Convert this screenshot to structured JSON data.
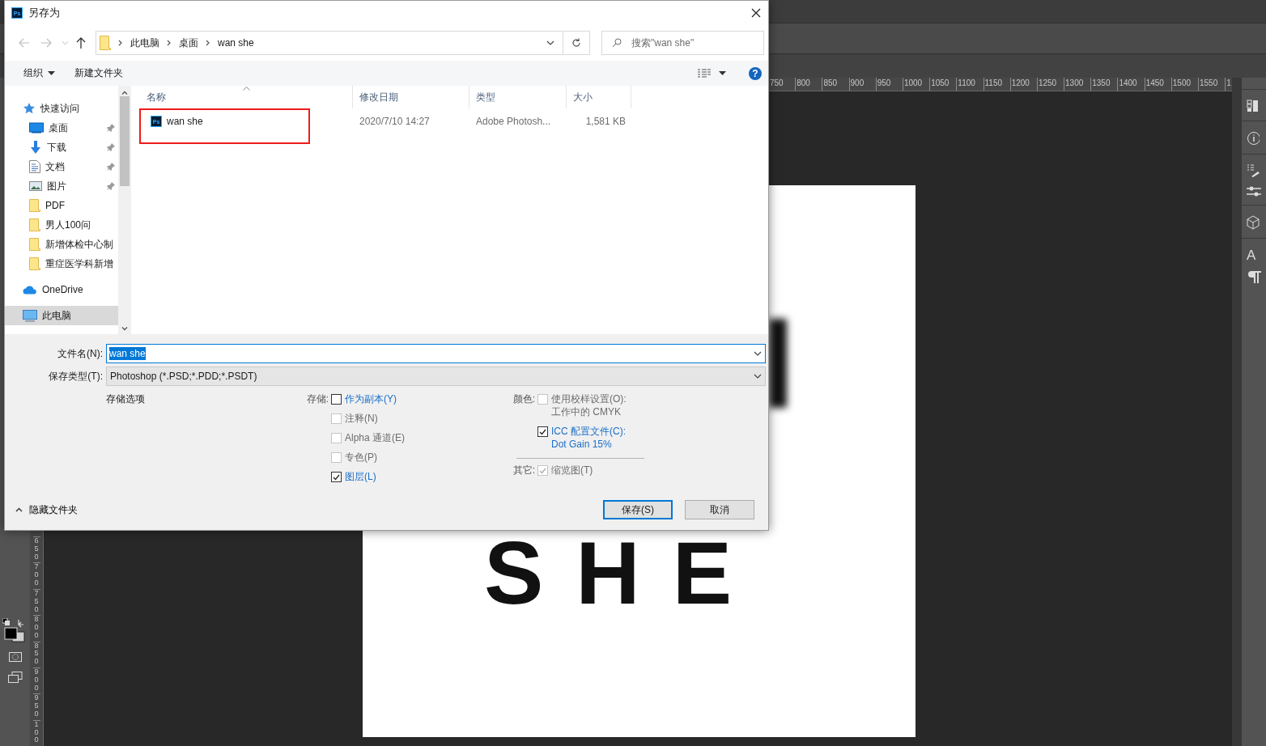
{
  "photoshop": {
    "h_ruler": [
      "750",
      "800",
      "850",
      "900",
      "950",
      "1000",
      "1050",
      "1100",
      "1150",
      "1200",
      "1250",
      "1300",
      "1350",
      "1400",
      "1450",
      "1500",
      "1550",
      "1"
    ],
    "v_ruler": [
      "650",
      "700",
      "750",
      "800",
      "850",
      "900",
      "950",
      "100"
    ],
    "canvas_text": "SHE",
    "panel_letter": "A"
  },
  "dialog": {
    "icon_label": "Ps",
    "title": "另存为",
    "breadcrumb": [
      "此电脑",
      "桌面",
      "wan she"
    ],
    "search": {
      "placeholder": "搜索\"wan she\""
    },
    "toolbar": {
      "organize": "组织",
      "new_folder": "新建文件夹",
      "help": "?"
    },
    "sidebar": [
      {
        "label": "快速访问",
        "kind": "star",
        "pinned": false,
        "selected": false,
        "children": [
          {
            "label": "桌面",
            "kind": "desktop",
            "pinned": true,
            "selected": false
          },
          {
            "label": "下载",
            "kind": "download",
            "pinned": true,
            "selected": false
          },
          {
            "label": "文档",
            "kind": "document",
            "pinned": true,
            "selected": false
          },
          {
            "label": "图片",
            "kind": "pictures",
            "pinned": true,
            "selected": false
          },
          {
            "label": "PDF",
            "kind": "folder",
            "pinned": false,
            "selected": false
          },
          {
            "label": "男人100问",
            "kind": "folder",
            "pinned": false,
            "selected": false
          },
          {
            "label": "新增体检中心制",
            "kind": "folder",
            "pinned": false,
            "selected": false
          },
          {
            "label": "重症医学科新增",
            "kind": "folder",
            "pinned": false,
            "selected": false
          }
        ]
      },
      {
        "label": "OneDrive",
        "kind": "cloud",
        "pinned": false,
        "selected": false
      },
      {
        "label": "此电脑",
        "kind": "computer",
        "pinned": false,
        "selected": true
      }
    ],
    "columns": [
      {
        "label": "名称",
        "sorted": true
      },
      {
        "label": "修改日期",
        "sorted": false
      },
      {
        "label": "类型",
        "sorted": false
      },
      {
        "label": "大小",
        "sorted": false
      }
    ],
    "rows": [
      {
        "icon_label": "Ps",
        "name": "wan she",
        "date": "2020/7/10 14:27",
        "type": "Adobe Photosh...",
        "size": "1,581 KB",
        "highlighted": true
      }
    ],
    "filename": {
      "label": "文件名(N):",
      "value": "wan she",
      "text_selected": true
    },
    "filetype": {
      "label": "保存类型(T):",
      "value": "Photoshop (*.PSD;*.PDD;*.PSDT)"
    },
    "options": {
      "title": "存储选项",
      "groups": [
        {
          "label": "存储:",
          "items": [
            {
              "label": "作为副本(Y)",
              "checked": false,
              "disabled": false
            },
            {
              "label": "注释(N)",
              "checked": false,
              "disabled": true
            },
            {
              "label": "Alpha 通道(E)",
              "checked": false,
              "disabled": true
            },
            {
              "label": "专色(P)",
              "checked": false,
              "disabled": true
            },
            {
              "label": "图层(L)",
              "checked": true,
              "disabled": false
            }
          ]
        },
        {
          "label": "颜色:",
          "items": [
            {
              "label": "使用校样设置(O): 工作中的 CMYK",
              "checked": false,
              "disabled": true
            },
            {
              "label": "ICC 配置文件(C): Dot Gain 15%",
              "checked": true,
              "disabled": false
            }
          ]
        },
        {
          "label": "其它:",
          "items": [
            {
              "label": "缩览图(T)",
              "checked": true,
              "disabled": true
            }
          ]
        }
      ]
    },
    "hide_folders": "隐藏文件夹",
    "buttons": [
      {
        "label": "保存(S)",
        "default": true
      },
      {
        "label": "取消",
        "default": false
      }
    ]
  }
}
